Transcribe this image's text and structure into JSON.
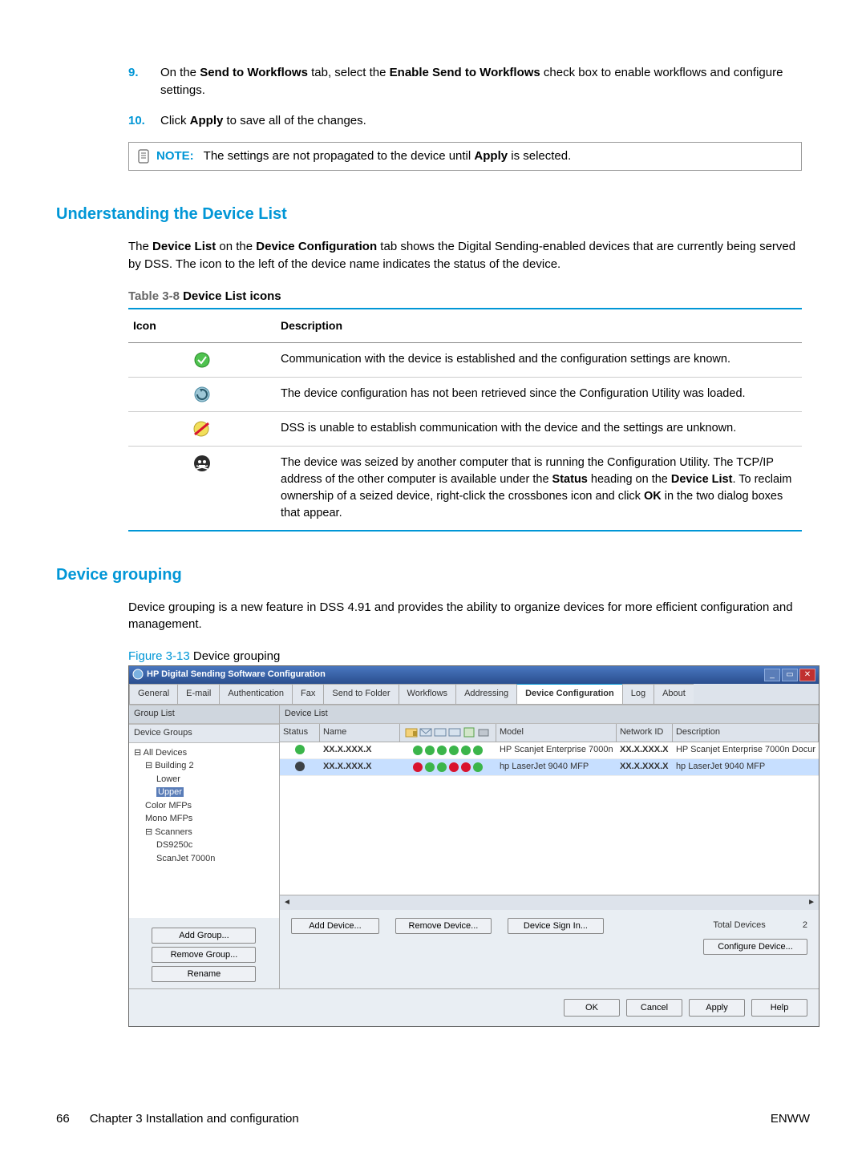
{
  "steps": {
    "s9": {
      "num": "9.",
      "text_a": "On the ",
      "b1": "Send to Workflows",
      "text_b": " tab, select the ",
      "b2": "Enable Send to Workflows",
      "text_c": " check box to enable workflows and configure settings."
    },
    "s10": {
      "num": "10.",
      "text_a": "Click ",
      "b1": "Apply",
      "text_b": " to save all of the changes."
    }
  },
  "note": {
    "label": "NOTE:",
    "text_a": "The settings are not propagated to the device until ",
    "b1": "Apply",
    "text_b": " is selected."
  },
  "section1": {
    "heading": "Understanding the Device List",
    "para_a": "The ",
    "b1": "Device List",
    "para_b": " on the ",
    "b2": "Device Configuration",
    "para_c": " tab shows the Digital Sending-enabled devices that are currently being served by DSS. The icon to the left of the device name indicates the status of the device.",
    "table_label_a": "Table 3-8",
    "table_label_b": "  Device List icons",
    "col1": "Icon",
    "col2": "Description",
    "row1": "Communication with the device is established and the configuration settings are known.",
    "row2": "The device configuration has not been retrieved since the Configuration Utility was loaded.",
    "row3": "DSS is unable to establish communication with the device and the settings are unknown.",
    "row4_a": "The device was seized by another computer that is running the Configuration Utility. The TCP/IP address of the other computer is available under the ",
    "row4_b": "Status",
    "row4_c": " heading on the ",
    "row4_d": "Device List",
    "row4_e": ". To reclaim ownership of a seized device, right-click the crossbones icon and click ",
    "row4_f": "OK",
    "row4_g": " in the two dialog boxes that appear."
  },
  "section2": {
    "heading": "Device grouping",
    "para": "Device grouping is a new feature in DSS 4.91 and provides the ability to organize devices for more efficient configuration and management.",
    "fig_label_a": "Figure 3-13",
    "fig_label_b": "  Device grouping"
  },
  "screenshot": {
    "title": "HP Digital Sending Software Configuration",
    "tabs": [
      "General",
      "E-mail",
      "Authentication",
      "Fax",
      "Send to Folder",
      "Workflows",
      "Addressing",
      "Device Configuration",
      "Log",
      "About"
    ],
    "group_list_label": "Group List",
    "device_list_label": "Device List",
    "tree": {
      "n0": "All Devices",
      "n1": "Building 2",
      "n2": "Lower",
      "n3": "Upper",
      "n4": "Color MFPs",
      "n5": "Mono MFPs",
      "n6": "Scanners",
      "n7": "DS9250c",
      "n8": "ScanJet 7000n"
    },
    "tree_selected": "Upper",
    "group_buttons": [
      "Add Group...",
      "Remove Group...",
      "Rename"
    ],
    "device_groups_header": "Device Groups",
    "grid_headers": [
      "Status",
      "Name",
      "Model",
      "Network ID",
      "Description"
    ],
    "rows": [
      {
        "status": "green",
        "name": "XX.X.XXX.X",
        "model": "HP Scanjet Enterprise 7000n",
        "netid": "XX.X.XXX.X",
        "desc": "HP Scanjet Enterprise 7000n Docur"
      },
      {
        "status": "dark",
        "name": "XX.X.XXX.X",
        "model": "hp LaserJet 9040 MFP",
        "netid": "XX.X.XXX.X",
        "desc": "hp LaserJet 9040 MFP"
      }
    ],
    "device_buttons": {
      "add": "Add Device...",
      "remove": "Remove Device...",
      "signin": "Device Sign In..."
    },
    "total_devices_label": "Total Devices",
    "total_devices": "2",
    "configure": "Configure Device...",
    "bottom": [
      "OK",
      "Cancel",
      "Apply",
      "Help"
    ]
  },
  "footer": {
    "left_num": "66",
    "left_text": "Chapter 3   Installation and configuration",
    "right": "ENWW"
  }
}
